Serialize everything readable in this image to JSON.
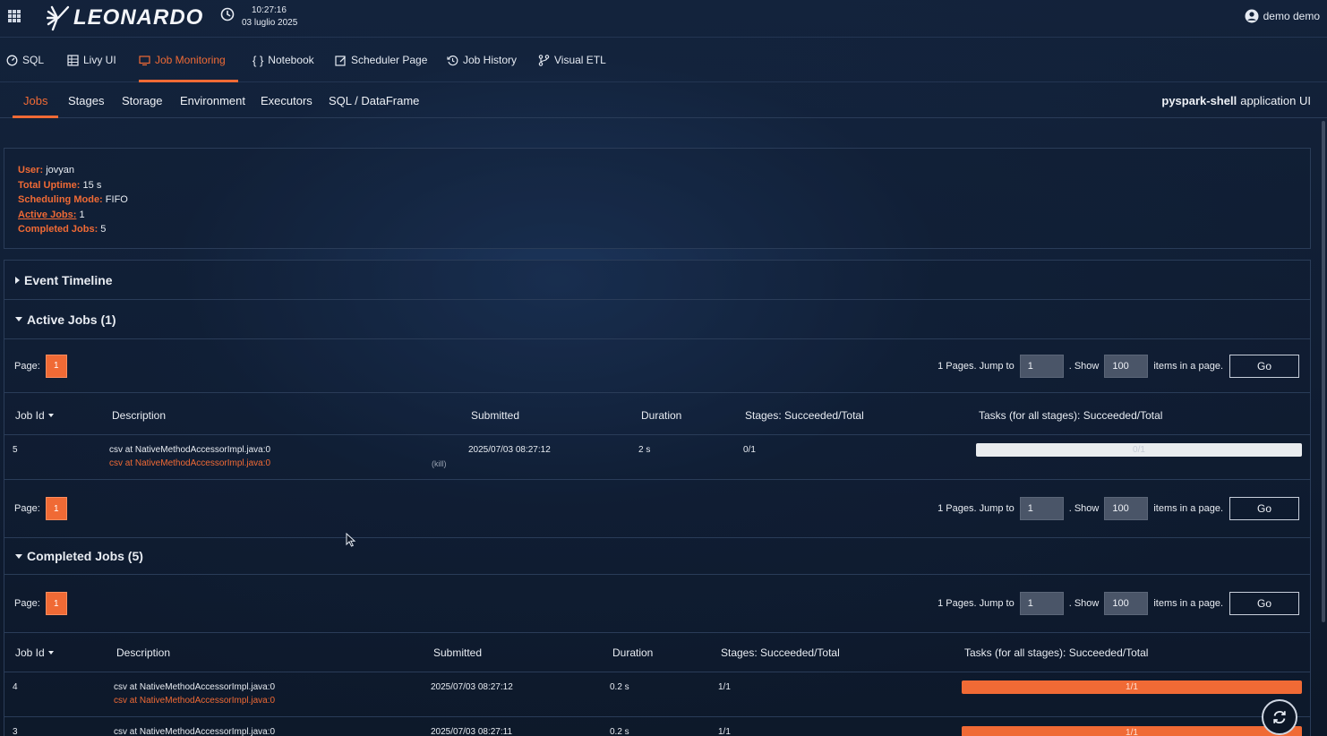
{
  "topbar": {
    "brand": "LEONARDO",
    "time": "10:27:16",
    "date": "03 luglio 2025",
    "user": "demo demo"
  },
  "nav": {
    "items": [
      {
        "label": "SQL",
        "icon": "gauge-icon"
      },
      {
        "label": "Livy UI",
        "icon": "grid-icon"
      },
      {
        "label": "Job Monitoring",
        "icon": "monitor-icon",
        "active": true
      },
      {
        "label": "Notebook",
        "icon": "braces-icon"
      },
      {
        "label": "Scheduler Page",
        "icon": "calendar-edit-icon"
      },
      {
        "label": "Job History",
        "icon": "history-icon"
      },
      {
        "label": "Visual ETL",
        "icon": "flow-icon"
      }
    ]
  },
  "spark_tabs": {
    "items": [
      "Jobs",
      "Stages",
      "Storage",
      "Environment",
      "Executors",
      "SQL / DataFrame"
    ],
    "app_name": "pyspark-shell",
    "app_suffix": "application UI"
  },
  "summary": {
    "user_label": "User:",
    "user": "jovyan",
    "uptime_label": "Total Uptime:",
    "uptime": "15 s",
    "mode_label": "Scheduling Mode:",
    "mode": "FIFO",
    "active_label": "Active Jobs:",
    "active": "1",
    "completed_label": "Completed Jobs:",
    "completed": "5"
  },
  "sections": {
    "timeline": "Event Timeline",
    "active": "Active Jobs (1)",
    "completed": "Completed Jobs (5)"
  },
  "pager": {
    "page_label": "Page:",
    "page": "1",
    "pages_text": "1 Pages. Jump to",
    "jump_value": "1",
    "show_text": ". Show",
    "show_value": "100",
    "items_text": "items in a page.",
    "go": "Go"
  },
  "columns": {
    "job_id": "Job Id",
    "description": "Description",
    "submitted": "Submitted",
    "duration": "Duration",
    "stages": "Stages: Succeeded/Total",
    "tasks": "Tasks (for all stages): Succeeded/Total"
  },
  "active_jobs": [
    {
      "id": "5",
      "desc": "csv at NativeMethodAccessorImpl.java:0",
      "desc_link": "csv at NativeMethodAccessorImpl.java:0",
      "kill": "(kill)",
      "submitted": "2025/07/03 08:27:12",
      "duration": "2 s",
      "stages": "0/1",
      "tasks": "0/1",
      "progress": 0
    }
  ],
  "completed_jobs": [
    {
      "id": "4",
      "desc": "csv at NativeMethodAccessorImpl.java:0",
      "desc_link": "csv at NativeMethodAccessorImpl.java:0",
      "submitted": "2025/07/03 08:27:12",
      "duration": "0.2 s",
      "stages": "1/1",
      "tasks": "1/1",
      "progress": 1
    },
    {
      "id": "3",
      "desc": "csv at NativeMethodAccessorImpl.java:0",
      "submitted": "2025/07/03 08:27:11",
      "duration": "0.2 s",
      "stages": "1/1",
      "tasks": "1/1",
      "progress": 1
    }
  ],
  "colors": {
    "accent": "#f06a35",
    "background": "#0f1a2b"
  }
}
